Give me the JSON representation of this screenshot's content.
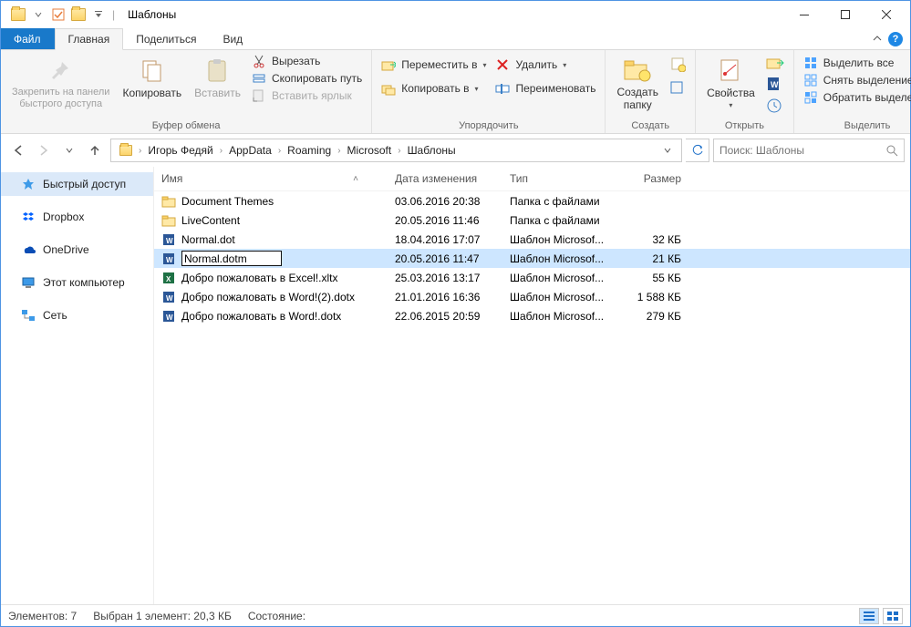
{
  "window": {
    "title": "Шаблоны"
  },
  "tabs": {
    "file": "Файл",
    "home": "Главная",
    "share": "Поделиться",
    "view": "Вид"
  },
  "ribbon": {
    "clipboard": {
      "pin": "Закрепить на панели\nбыстрого доступа",
      "copy": "Копировать",
      "paste": "Вставить",
      "cut": "Вырезать",
      "copypath": "Скопировать путь",
      "pasteshortcut": "Вставить ярлык",
      "label": "Буфер обмена"
    },
    "organize": {
      "moveto": "Переместить в",
      "copyto": "Копировать в",
      "delete": "Удалить",
      "rename": "Переименовать",
      "label": "Упорядочить"
    },
    "new": {
      "newfolder": "Создать\nпапку",
      "label": "Создать"
    },
    "open": {
      "properties": "Свойства",
      "label": "Открыть"
    },
    "select": {
      "selectall": "Выделить все",
      "selectnone": "Снять выделение",
      "invert": "Обратить выделение",
      "label": "Выделить"
    }
  },
  "breadcrumb": {
    "items": [
      "Игорь Федяй",
      "AppData",
      "Roaming",
      "Microsoft",
      "Шаблоны"
    ]
  },
  "search": {
    "placeholder": "Поиск: Шаблоны"
  },
  "sidebar": {
    "quick": "Быстрый доступ",
    "dropbox": "Dropbox",
    "onedrive": "OneDrive",
    "thispc": "Этот компьютер",
    "network": "Сеть"
  },
  "columns": {
    "name": "Имя",
    "date": "Дата изменения",
    "type": "Тип",
    "size": "Размер"
  },
  "files": [
    {
      "icon": "folder",
      "name": "Document Themes",
      "date": "03.06.2016 20:38",
      "type": "Папка с файлами",
      "size": ""
    },
    {
      "icon": "folder",
      "name": "LiveContent",
      "date": "20.05.2016 11:46",
      "type": "Папка с файлами",
      "size": ""
    },
    {
      "icon": "word",
      "name": "Normal.dot",
      "date": "18.04.2016 17:07",
      "type": "Шаблон Microsof...",
      "size": "32 КБ"
    },
    {
      "icon": "word",
      "name": "Normal.dotm",
      "date": "20.05.2016 11:47",
      "type": "Шаблон Microsof...",
      "size": "21 КБ",
      "selected": true,
      "editing": true
    },
    {
      "icon": "excel",
      "name": "Добро пожаловать в Excel!.xltx",
      "date": "25.03.2016 13:17",
      "type": "Шаблон Microsof...",
      "size": "55 КБ"
    },
    {
      "icon": "word",
      "name": "Добро пожаловать в Word!(2).dotx",
      "date": "21.01.2016 16:36",
      "type": "Шаблон Microsof...",
      "size": "1 588 КБ"
    },
    {
      "icon": "word",
      "name": "Добро пожаловать в Word!.dotx",
      "date": "22.06.2015 20:59",
      "type": "Шаблон Microsof...",
      "size": "279 КБ"
    }
  ],
  "status": {
    "count": "Элементов: 7",
    "selected": "Выбран 1 элемент: 20,3 КБ",
    "state": "Состояние:"
  }
}
